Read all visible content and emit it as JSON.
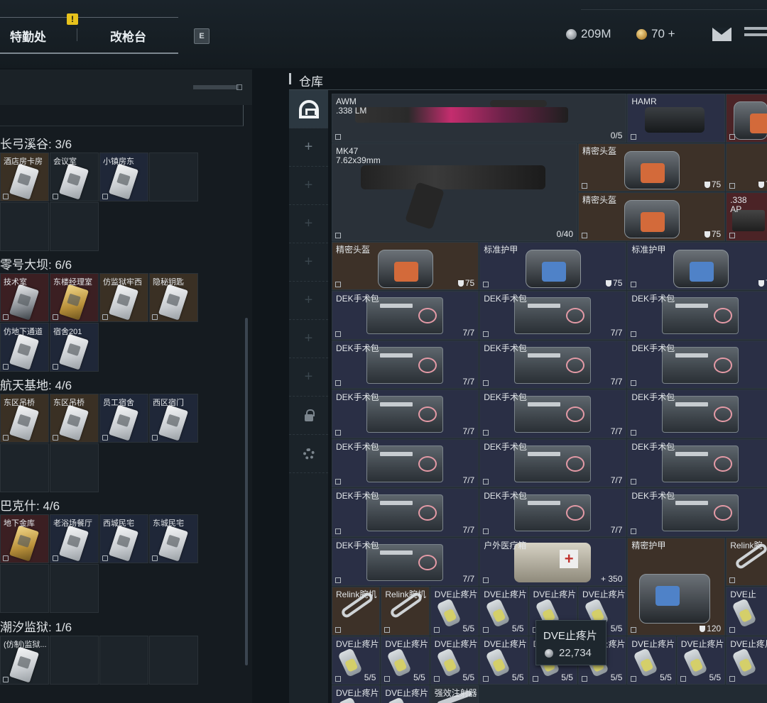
{
  "topbar": {
    "alert_badge": "!",
    "tab_agency": "特勤处",
    "tab_gunsmith": "改枪台",
    "key_hint": "E",
    "coins": "209M",
    "tokens": "70 +"
  },
  "left_groups": [
    {
      "title": "长弓溪谷: 3/6",
      "slots": [
        {
          "label": "酒店房卡房",
          "tone": "brown",
          "card": "silver"
        },
        {
          "label": "会议室",
          "tone": "dark",
          "card": "silver"
        },
        {
          "label": "小镇房东",
          "tone": "blue",
          "card": "silver"
        },
        {
          "label": "",
          "tone": "dark",
          "card": ""
        },
        {
          "label": "",
          "tone": "dark",
          "card": ""
        },
        {
          "label": "",
          "tone": "dark",
          "card": ""
        }
      ]
    },
    {
      "title": "零号大坝: 6/6",
      "slots": [
        {
          "label": "技术室",
          "tone": "red",
          "card": "dark"
        },
        {
          "label": "东楼经理室",
          "tone": "red",
          "card": "gold"
        },
        {
          "label": "仿监狱牢西",
          "tone": "brown",
          "card": "silver"
        },
        {
          "label": "隐秘钥匙",
          "tone": "brown",
          "card": "silver"
        },
        {
          "label": "仿地下通道",
          "tone": "blue",
          "card": "silver"
        },
        {
          "label": "宿舍201",
          "tone": "blue",
          "card": "silver"
        }
      ]
    },
    {
      "title": "航天基地: 4/6",
      "slots": [
        {
          "label": "东区吊桥",
          "tone": "brown",
          "card": "silver"
        },
        {
          "label": "东区吊桥",
          "tone": "brown",
          "card": "silver"
        },
        {
          "label": "员工宿舍",
          "tone": "blue",
          "card": "silver"
        },
        {
          "label": "西区宿门",
          "tone": "blue",
          "card": "silver"
        },
        {
          "label": "",
          "tone": "dark",
          "card": ""
        },
        {
          "label": "",
          "tone": "dark",
          "card": ""
        }
      ]
    },
    {
      "title": "巴克什: 4/6",
      "slots": [
        {
          "label": "地下金库",
          "tone": "red",
          "card": "gold"
        },
        {
          "label": "老浴场餐厅",
          "tone": "blue",
          "card": "silver"
        },
        {
          "label": "西城民宅",
          "tone": "blue",
          "card": "silver"
        },
        {
          "label": "东城民宅",
          "tone": "blue",
          "card": "silver"
        },
        {
          "label": "",
          "tone": "dark",
          "card": ""
        },
        {
          "label": "",
          "tone": "dark",
          "card": ""
        }
      ]
    },
    {
      "title": "潮汐监狱: 1/6",
      "slots": [
        {
          "label": "(仿制)监狱...",
          "tone": "dark",
          "card": "silver"
        },
        {
          "label": "",
          "tone": "dark",
          "card": ""
        },
        {
          "label": "",
          "tone": "dark",
          "card": ""
        },
        {
          "label": "",
          "tone": "dark",
          "card": ""
        }
      ]
    }
  ],
  "warehouse": {
    "title": "仓库",
    "items": [
      {
        "name": "AWM\n.338 LM",
        "val": "0/5",
        "tone": "dark",
        "art": "rifle",
        "r": 0,
        "c": 0,
        "w": 6,
        "h": 1
      },
      {
        "name": "HAMR",
        "val": "",
        "tone": "navy",
        "art": "scope",
        "r": 0,
        "c": 6,
        "w": 2,
        "h": 1
      },
      {
        "name": "",
        "val": "",
        "tone": "red",
        "art": "bag",
        "r": 0,
        "c": 8,
        "w": 1,
        "h": 1
      },
      {
        "name": "MK47\n7.62x39mm",
        "val": "0/40",
        "tone": "dark",
        "art": "ak",
        "r": 1,
        "c": 0,
        "w": 5,
        "h": 2
      },
      {
        "name": "精密头盔",
        "val": "75",
        "shield": true,
        "tone": "brown",
        "art": "bag",
        "r": 1,
        "c": 5,
        "w": 3,
        "h": 1
      },
      {
        "name": "",
        "val": "7",
        "shield": true,
        "tone": "brown",
        "art": "",
        "r": 1,
        "c": 8,
        "w": 1,
        "h": 1
      },
      {
        "name": "精密头盔",
        "val": "75",
        "shield": true,
        "tone": "brown",
        "art": "bag",
        "r": 2,
        "c": 5,
        "w": 3,
        "h": 1
      },
      {
        "name": ".338\nAP",
        "val": "",
        "tone": "red",
        "art": "ap",
        "r": 2,
        "c": 8,
        "w": 1,
        "h": 1
      },
      {
        "name": "精密头盔",
        "val": "75",
        "shield": true,
        "tone": "brown",
        "art": "bag",
        "r": 3,
        "c": 0,
        "w": 3,
        "h": 1
      },
      {
        "name": "标准护甲",
        "val": "75",
        "shield": true,
        "tone": "navy",
        "art": "bag-blue",
        "r": 3,
        "c": 3,
        "w": 3,
        "h": 1
      },
      {
        "name": "标准护甲",
        "val": "7",
        "shield": true,
        "tone": "navy",
        "art": "bag-blue",
        "r": 3,
        "c": 6,
        "w": 3,
        "h": 1
      },
      {
        "name": "DEK手术包",
        "val": "7/7",
        "tone": "navy",
        "art": "medkit",
        "r": 4,
        "c": 0,
        "w": 3,
        "h": 1
      },
      {
        "name": "DEK手术包",
        "val": "7/7",
        "tone": "navy",
        "art": "medkit",
        "r": 4,
        "c": 3,
        "w": 3,
        "h": 1
      },
      {
        "name": "DEK手术包",
        "val": "",
        "tone": "navy",
        "art": "medkit",
        "r": 4,
        "c": 6,
        "w": 3,
        "h": 1
      },
      {
        "name": "DEK手术包",
        "val": "7/7",
        "tone": "navy",
        "art": "medkit",
        "r": 5,
        "c": 0,
        "w": 3,
        "h": 1
      },
      {
        "name": "DEK手术包",
        "val": "7/7",
        "tone": "navy",
        "art": "medkit",
        "r": 5,
        "c": 3,
        "w": 3,
        "h": 1
      },
      {
        "name": "DEK手术包",
        "val": "",
        "tone": "navy",
        "art": "medkit",
        "r": 5,
        "c": 6,
        "w": 3,
        "h": 1
      },
      {
        "name": "DEK手术包",
        "val": "7/7",
        "tone": "navy",
        "art": "medkit",
        "r": 6,
        "c": 0,
        "w": 3,
        "h": 1
      },
      {
        "name": "DEK手术包",
        "val": "7/7",
        "tone": "navy",
        "art": "medkit",
        "r": 6,
        "c": 3,
        "w": 3,
        "h": 1
      },
      {
        "name": "DEK手术包",
        "val": "",
        "tone": "navy",
        "art": "medkit",
        "r": 6,
        "c": 6,
        "w": 3,
        "h": 1
      },
      {
        "name": "DEK手术包",
        "val": "7/7",
        "tone": "navy",
        "art": "medkit",
        "r": 7,
        "c": 0,
        "w": 3,
        "h": 1
      },
      {
        "name": "DEK手术包",
        "val": "7/7",
        "tone": "navy",
        "art": "medkit",
        "r": 7,
        "c": 3,
        "w": 3,
        "h": 1
      },
      {
        "name": "DEK手术包",
        "val": "",
        "tone": "navy",
        "art": "medkit",
        "r": 7,
        "c": 6,
        "w": 3,
        "h": 1
      },
      {
        "name": "DEK手术包",
        "val": "7/7",
        "tone": "navy",
        "art": "medkit",
        "r": 8,
        "c": 0,
        "w": 3,
        "h": 1
      },
      {
        "name": "DEK手术包",
        "val": "7/7",
        "tone": "navy",
        "art": "medkit",
        "r": 8,
        "c": 3,
        "w": 3,
        "h": 1
      },
      {
        "name": "DEK手术包",
        "val": "",
        "tone": "navy",
        "art": "medkit",
        "r": 8,
        "c": 6,
        "w": 3,
        "h": 1
      },
      {
        "name": "DEK手术包",
        "val": "7/7",
        "tone": "navy",
        "art": "medkit",
        "r": 9,
        "c": 0,
        "w": 3,
        "h": 1
      },
      {
        "name": "户外医疗箱",
        "val": "+ 350",
        "tone": "navy",
        "art": "outdoor",
        "r": 9,
        "c": 3,
        "w": 3,
        "h": 1
      },
      {
        "name": "精密护甲",
        "val": "120",
        "shield": true,
        "tone": "brown",
        "art": "bag-blue",
        "r": 9,
        "c": 6,
        "w": 2,
        "h": 2
      },
      {
        "name": "Relink腕",
        "val": "",
        "tone": "brown",
        "art": "relink",
        "r": 9,
        "c": 8,
        "w": 1,
        "h": 1
      },
      {
        "name": "Relink腕机",
        "val": "",
        "tone": "brown",
        "art": "relink",
        "r": 10,
        "c": 0,
        "w": 1,
        "h": 1
      },
      {
        "name": "Relink腕机",
        "val": "",
        "tone": "brown",
        "art": "relink",
        "r": 10,
        "c": 1,
        "w": 1,
        "h": 1
      },
      {
        "name": "DVE止疼片",
        "val": "5/5",
        "tone": "navy",
        "art": "pills",
        "r": 10,
        "c": 2,
        "w": 1,
        "h": 1
      },
      {
        "name": "DVE止疼片",
        "val": "5/5",
        "tone": "navy",
        "art": "pills",
        "r": 10,
        "c": 3,
        "w": 1,
        "h": 1
      },
      {
        "name": "DVE止疼片",
        "val": "",
        "tone": "navy",
        "art": "pills",
        "r": 10,
        "c": 4,
        "w": 1,
        "h": 1
      },
      {
        "name": "DVE止疼片",
        "val": "5/5",
        "tone": "navy",
        "art": "pills",
        "r": 10,
        "c": 5,
        "w": 1,
        "h": 1
      },
      {
        "name": "DVE止",
        "val": "",
        "tone": "navy",
        "art": "pills",
        "r": 10,
        "c": 8,
        "w": 1,
        "h": 1
      },
      {
        "name": "DVE止疼片",
        "val": "5/5",
        "tone": "navy",
        "art": "pills",
        "r": 11,
        "c": 0,
        "w": 1,
        "h": 1
      },
      {
        "name": "DVE止疼片",
        "val": "5/5",
        "tone": "navy",
        "art": "pills",
        "r": 11,
        "c": 1,
        "w": 1,
        "h": 1
      },
      {
        "name": "DVE止疼片",
        "val": "5/5",
        "tone": "navy",
        "art": "pills",
        "r": 11,
        "c": 2,
        "w": 1,
        "h": 1
      },
      {
        "name": "DVE止疼片",
        "val": "5/5",
        "tone": "navy",
        "art": "pills",
        "r": 11,
        "c": 3,
        "w": 1,
        "h": 1
      },
      {
        "name": "DVE止疼片",
        "val": "5/5",
        "tone": "navy",
        "art": "pills",
        "r": 11,
        "c": 4,
        "w": 1,
        "h": 1
      },
      {
        "name": "DVE止疼片",
        "val": "5/5",
        "tone": "navy",
        "art": "pills",
        "r": 11,
        "c": 5,
        "w": 1,
        "h": 1
      },
      {
        "name": "DVE止疼片",
        "val": "5/5",
        "tone": "navy",
        "art": "pills",
        "r": 11,
        "c": 6,
        "w": 1,
        "h": 1
      },
      {
        "name": "DVE止疼片",
        "val": "5/5",
        "tone": "navy",
        "art": "pills",
        "r": 11,
        "c": 7,
        "w": 1,
        "h": 1
      },
      {
        "name": "DVE止疼片",
        "val": "",
        "tone": "navy",
        "art": "pills",
        "r": 11,
        "c": 8,
        "w": 1,
        "h": 1
      },
      {
        "name": "DVE止疼片",
        "val": "",
        "tone": "navy",
        "art": "pills",
        "r": 12,
        "c": 0,
        "w": 1,
        "h": 1
      },
      {
        "name": "DVE止疼片",
        "val": "",
        "tone": "navy",
        "art": "pills",
        "r": 12,
        "c": 1,
        "w": 1,
        "h": 1
      },
      {
        "name": "强效注射器",
        "val": "",
        "tone": "dark",
        "art": "syringe",
        "r": 12,
        "c": 2,
        "w": 1,
        "h": 1
      }
    ]
  },
  "tooltip": {
    "title": "DVE止疼片",
    "price": "22,734"
  },
  "colors": {
    "accent_gold": "#e7c21c",
    "tone_brown": "#3d3128",
    "tone_navy": "#2a2f45",
    "tone_red": "#4b2326"
  }
}
